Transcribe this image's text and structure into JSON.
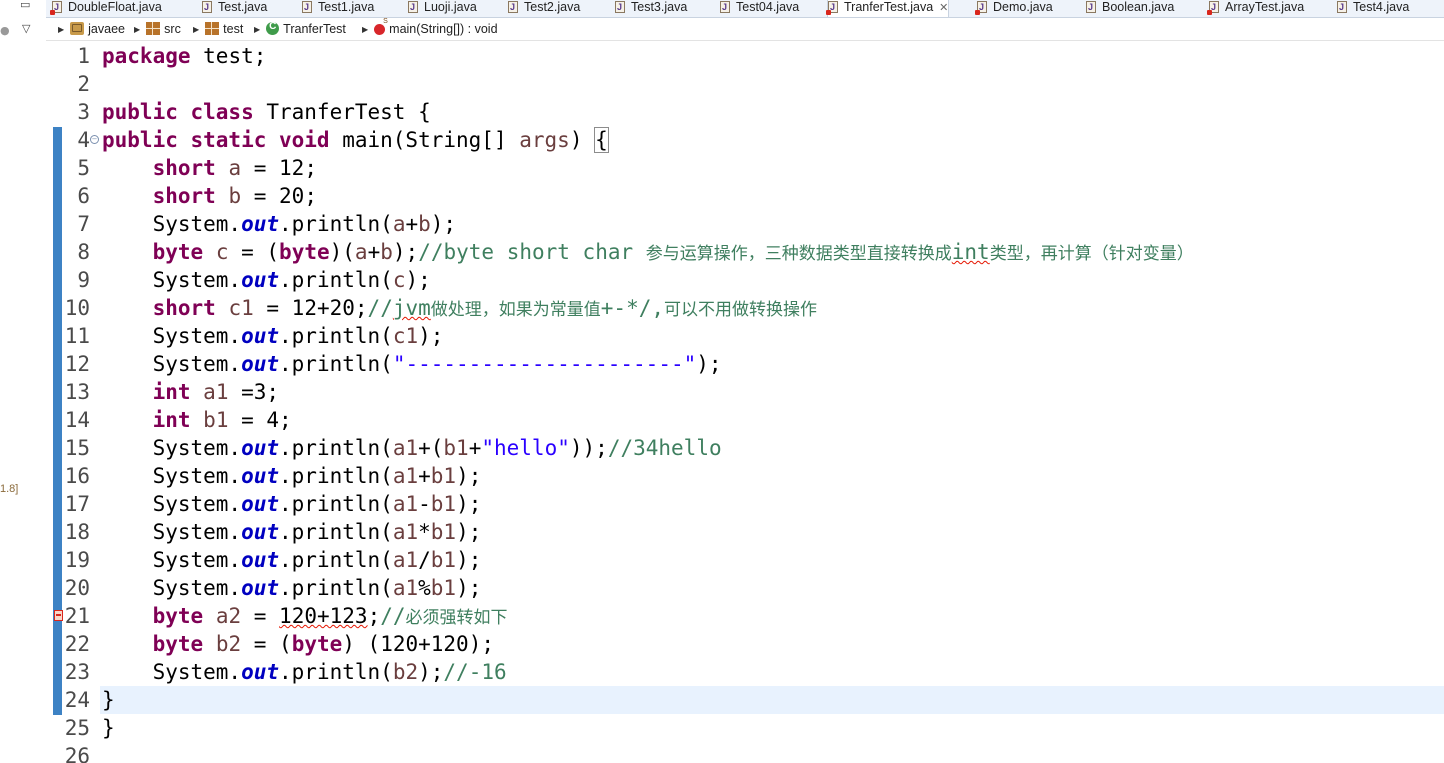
{
  "left_panel": {
    "jdk_label": "1.8]"
  },
  "tabs": [
    {
      "label": "DoubleFloat.java",
      "error": true
    },
    {
      "label": "Test.java",
      "error": false
    },
    {
      "label": "Test1.java",
      "error": false
    },
    {
      "label": "Luoji.java",
      "error": false
    },
    {
      "label": "Test2.java",
      "error": false
    },
    {
      "label": "Test3.java",
      "error": false
    },
    {
      "label": "Test04.java",
      "error": false
    },
    {
      "label": "TranferTest.java",
      "error": true,
      "active": true
    },
    {
      "label": "Demo.java",
      "error": true
    },
    {
      "label": "Boolean.java",
      "error": false
    },
    {
      "label": "ArrayTest.java",
      "error": true
    },
    {
      "label": "Test4.java",
      "error": false
    }
  ],
  "breadcrumb": {
    "project": "javaee",
    "folder": "src",
    "package": "test",
    "class": "TranferTest",
    "method": "main(String[]) : void"
  },
  "editor": {
    "current_line": 24,
    "error_line": 21,
    "lines": [
      {
        "n": "1",
        "segs": [
          [
            "kw",
            "package"
          ],
          [
            "p",
            " test;"
          ]
        ]
      },
      {
        "n": "2",
        "segs": []
      },
      {
        "n": "3",
        "segs": [
          [
            "kw",
            "public class"
          ],
          [
            "p",
            " TranferTest {"
          ]
        ]
      },
      {
        "n": "4",
        "segs": [
          [
            "kw",
            "public static void"
          ],
          [
            "p",
            " main(String[] "
          ],
          [
            "var",
            "args"
          ],
          [
            "p",
            ") "
          ],
          [
            "box",
            "{"
          ]
        ]
      },
      {
        "n": "5",
        "segs": [
          [
            "p",
            "    "
          ],
          [
            "kw",
            "short"
          ],
          [
            "p",
            " "
          ],
          [
            "var",
            "a"
          ],
          [
            "p",
            " = 12;"
          ]
        ]
      },
      {
        "n": "6",
        "segs": [
          [
            "p",
            "    "
          ],
          [
            "kw",
            "short"
          ],
          [
            "p",
            " "
          ],
          [
            "var",
            "b"
          ],
          [
            "p",
            " = 20;"
          ]
        ]
      },
      {
        "n": "7",
        "segs": [
          [
            "p",
            "    System."
          ],
          [
            "fld",
            "out"
          ],
          [
            "p",
            ".println("
          ],
          [
            "var",
            "a"
          ],
          [
            "p",
            "+"
          ],
          [
            "var",
            "b"
          ],
          [
            "p",
            ");"
          ]
        ]
      },
      {
        "n": "8",
        "segs": [
          [
            "p",
            "    "
          ],
          [
            "kw",
            "byte"
          ],
          [
            "p",
            " "
          ],
          [
            "var",
            "c"
          ],
          [
            "p",
            " = ("
          ],
          [
            "kw",
            "byte"
          ],
          [
            "p",
            ")("
          ],
          [
            "var",
            "a"
          ],
          [
            "p",
            "+"
          ],
          [
            "var",
            "b"
          ],
          [
            "p",
            ");"
          ],
          [
            "cmt",
            "//byte short char "
          ],
          [
            "cmtcjk",
            "参与运算操作，三种数据类型直接转换成"
          ],
          [
            "cmtsq",
            "int"
          ],
          [
            "cmtcjk",
            "类型，再计算（针对变量）"
          ]
        ]
      },
      {
        "n": "9",
        "segs": [
          [
            "p",
            "    System."
          ],
          [
            "fld",
            "out"
          ],
          [
            "p",
            ".println("
          ],
          [
            "var",
            "c"
          ],
          [
            "p",
            ");"
          ]
        ]
      },
      {
        "n": "10",
        "segs": [
          [
            "p",
            "    "
          ],
          [
            "kw",
            "short"
          ],
          [
            "p",
            " "
          ],
          [
            "var",
            "c1"
          ],
          [
            "p",
            " = 12+20;"
          ],
          [
            "cmt",
            "//"
          ],
          [
            "cmtsq",
            "jvm"
          ],
          [
            "cmtcjk",
            "做处理，如果为常量值"
          ],
          [
            "cmt",
            "+-*/,"
          ],
          [
            "cmtcjk",
            "可以不用做转换操作"
          ]
        ]
      },
      {
        "n": "11",
        "segs": [
          [
            "p",
            "    System."
          ],
          [
            "fld",
            "out"
          ],
          [
            "p",
            ".println("
          ],
          [
            "var",
            "c1"
          ],
          [
            "p",
            ");"
          ]
        ]
      },
      {
        "n": "12",
        "segs": [
          [
            "p",
            "    System."
          ],
          [
            "fld",
            "out"
          ],
          [
            "p",
            ".println("
          ],
          [
            "str",
            "\"----------------------\""
          ],
          [
            "p",
            ");"
          ]
        ]
      },
      {
        "n": "13",
        "segs": [
          [
            "p",
            "    "
          ],
          [
            "kw",
            "int"
          ],
          [
            "p",
            " "
          ],
          [
            "var",
            "a1"
          ],
          [
            "p",
            " =3;"
          ]
        ]
      },
      {
        "n": "14",
        "segs": [
          [
            "p",
            "    "
          ],
          [
            "kw",
            "int"
          ],
          [
            "p",
            " "
          ],
          [
            "var",
            "b1"
          ],
          [
            "p",
            " = 4;"
          ]
        ]
      },
      {
        "n": "15",
        "segs": [
          [
            "p",
            "    System."
          ],
          [
            "fld",
            "out"
          ],
          [
            "p",
            ".println("
          ],
          [
            "var",
            "a1"
          ],
          [
            "p",
            "+("
          ],
          [
            "var",
            "b1"
          ],
          [
            "p",
            "+"
          ],
          [
            "str",
            "\"hello\""
          ],
          [
            "p",
            "));"
          ],
          [
            "cmt",
            "//34hello"
          ]
        ]
      },
      {
        "n": "16",
        "segs": [
          [
            "p",
            "    System."
          ],
          [
            "fld",
            "out"
          ],
          [
            "p",
            ".println("
          ],
          [
            "var",
            "a1"
          ],
          [
            "p",
            "+"
          ],
          [
            "var",
            "b1"
          ],
          [
            "p",
            ");"
          ]
        ]
      },
      {
        "n": "17",
        "segs": [
          [
            "p",
            "    System."
          ],
          [
            "fld",
            "out"
          ],
          [
            "p",
            ".println("
          ],
          [
            "var",
            "a1"
          ],
          [
            "p",
            "-"
          ],
          [
            "var",
            "b1"
          ],
          [
            "p",
            ");"
          ]
        ]
      },
      {
        "n": "18",
        "segs": [
          [
            "p",
            "    System."
          ],
          [
            "fld",
            "out"
          ],
          [
            "p",
            ".println("
          ],
          [
            "var",
            "a1"
          ],
          [
            "p",
            "*"
          ],
          [
            "var",
            "b1"
          ],
          [
            "p",
            ");"
          ]
        ]
      },
      {
        "n": "19",
        "segs": [
          [
            "p",
            "    System."
          ],
          [
            "fld",
            "out"
          ],
          [
            "p",
            ".println("
          ],
          [
            "var",
            "a1"
          ],
          [
            "p",
            "/"
          ],
          [
            "var",
            "b1"
          ],
          [
            "p",
            ");"
          ]
        ]
      },
      {
        "n": "20",
        "segs": [
          [
            "p",
            "    System."
          ],
          [
            "fld",
            "out"
          ],
          [
            "p",
            ".println("
          ],
          [
            "var",
            "a1"
          ],
          [
            "p",
            "%"
          ],
          [
            "var",
            "b1"
          ],
          [
            "p",
            ");"
          ]
        ]
      },
      {
        "n": "21",
        "segs": [
          [
            "p",
            "    "
          ],
          [
            "kw",
            "byte"
          ],
          [
            "p",
            " "
          ],
          [
            "var",
            "a2"
          ],
          [
            "p",
            " = "
          ],
          [
            "sq",
            "120+123"
          ],
          [
            "p",
            ";"
          ],
          [
            "cmt",
            "//"
          ],
          [
            "cmtcjk",
            "必须强转如下"
          ]
        ]
      },
      {
        "n": "22",
        "segs": [
          [
            "p",
            "    "
          ],
          [
            "kw",
            "byte"
          ],
          [
            "p",
            " "
          ],
          [
            "var",
            "b2"
          ],
          [
            "p",
            " = ("
          ],
          [
            "kw",
            "byte"
          ],
          [
            "p",
            ") (120+120);"
          ]
        ]
      },
      {
        "n": "23",
        "segs": [
          [
            "p",
            "    System."
          ],
          [
            "fld",
            "out"
          ],
          [
            "p",
            ".println("
          ],
          [
            "var",
            "b2"
          ],
          [
            "p",
            ");"
          ],
          [
            "cmt",
            "//-16"
          ]
        ]
      },
      {
        "n": "24",
        "segs": [
          [
            "p",
            "}"
          ]
        ]
      },
      {
        "n": "25",
        "segs": [
          [
            "p",
            "}"
          ]
        ]
      },
      {
        "n": "26",
        "segs": []
      }
    ]
  }
}
